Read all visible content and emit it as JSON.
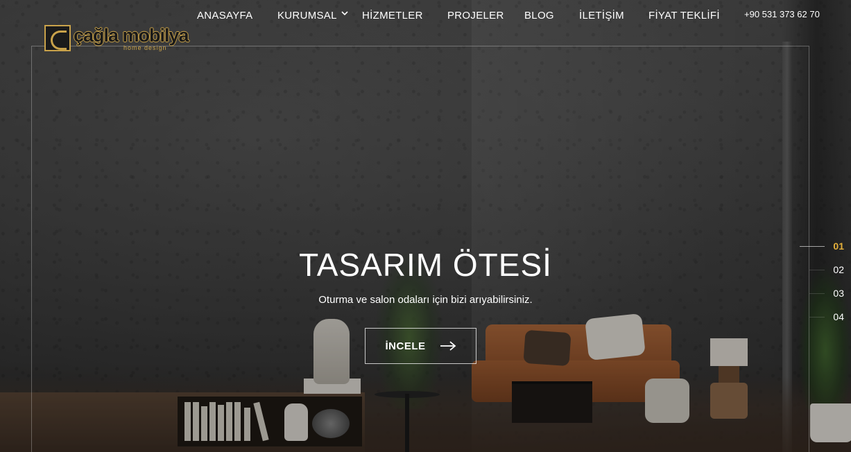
{
  "brand": {
    "logo_text": "çağla mobilya",
    "logo_sub": "home design"
  },
  "nav": {
    "items": [
      {
        "label": "ANASAYFA"
      },
      {
        "label": "KURUMSAL"
      },
      {
        "label": "HİZMETLER"
      },
      {
        "label": "PROJELER"
      },
      {
        "label": "BLOG"
      },
      {
        "label": "İLETİŞİM"
      },
      {
        "label": "FİYAT TEKLİFİ"
      }
    ],
    "phone": "+90 531 373 62 70"
  },
  "hero": {
    "title": "TASARIM ÖTESİ",
    "subtitle": "Oturma ve salon odaları için bizi arıyabilirsiniz.",
    "cta_label": "İNCELE"
  },
  "slider": {
    "pages": [
      "01",
      "02",
      "03",
      "04"
    ],
    "active": "01"
  },
  "colors": {
    "accent": "#e5b03b",
    "logo_gold": "#c9a24a",
    "text": "#ffffff"
  },
  "icons": {
    "nav_dropdown": "chevron-down-icon",
    "cta": "arrow-right-icon"
  }
}
